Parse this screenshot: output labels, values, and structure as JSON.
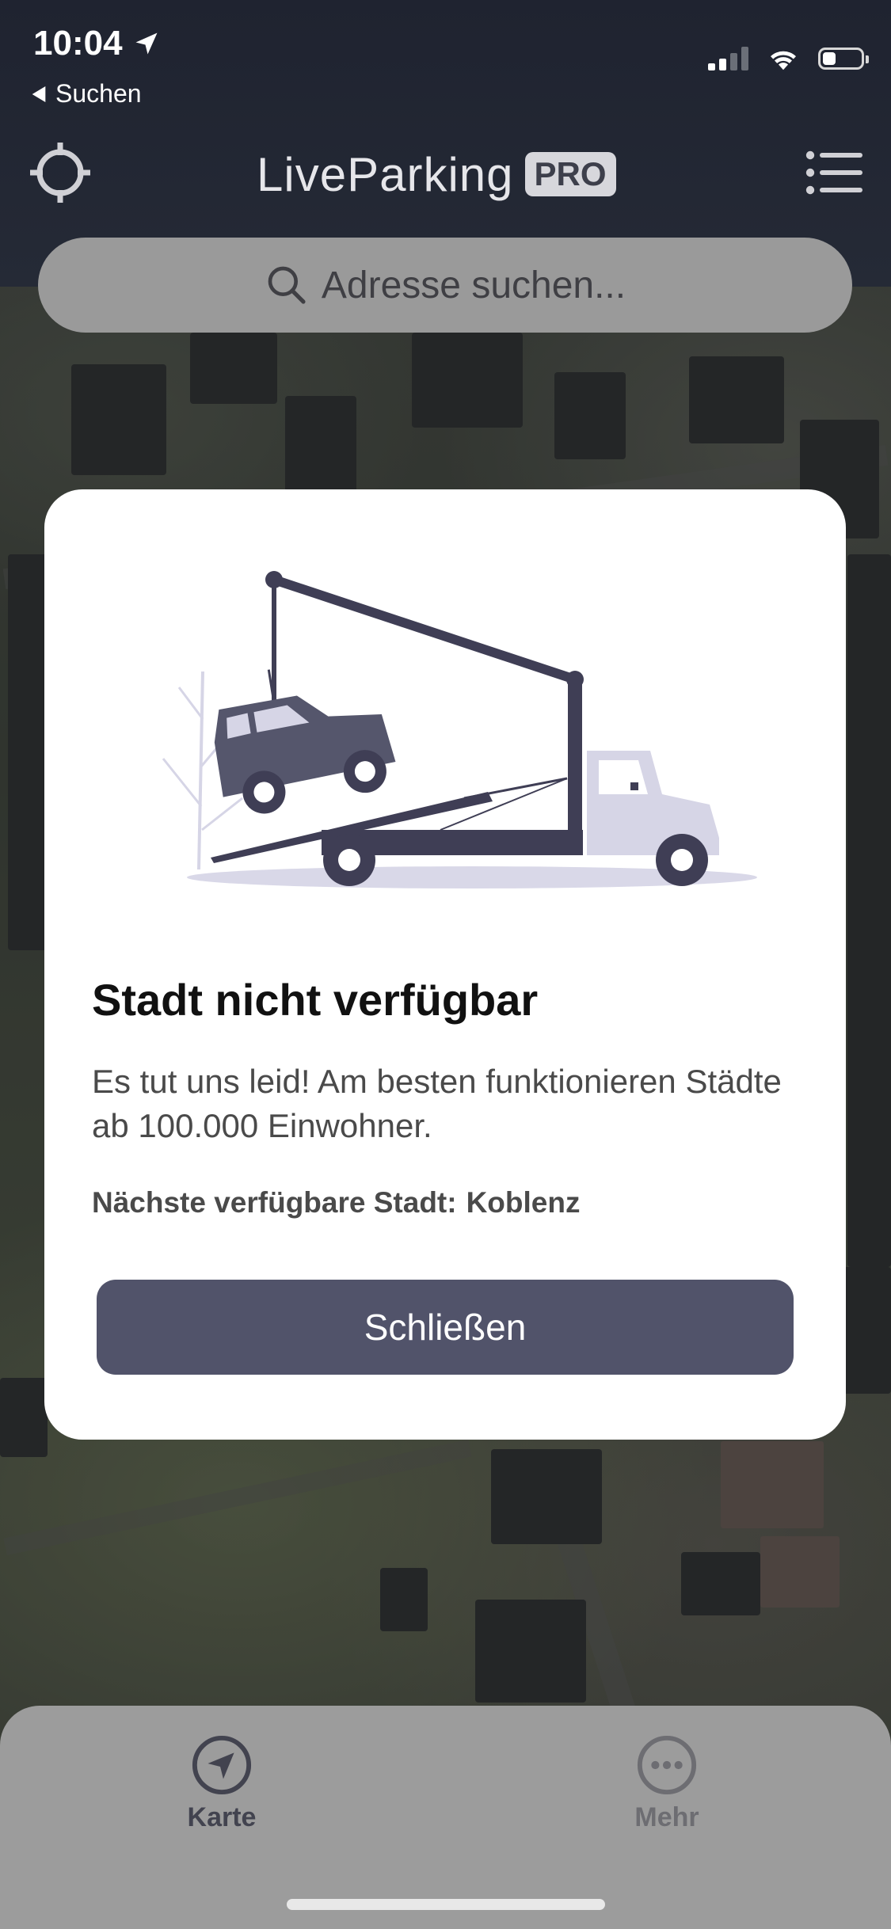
{
  "status_bar": {
    "time": "10:04",
    "back_label": "Suchen"
  },
  "header": {
    "logo_text": "LiveParking",
    "logo_badge": "PRO",
    "search_placeholder": "Adresse suchen..."
  },
  "modal": {
    "title": "Stadt nicht verfügbar",
    "description": "Es tut uns leid! Am besten funktionieren Städte ab 100.000 Einwohner.",
    "next_city_label": "Nächste verfügbare Stadt:",
    "next_city_value": "Koblenz",
    "close_button": "Schließen"
  },
  "tabbar": {
    "tabs": [
      {
        "label": "Karte",
        "icon": "navigation-arrow-icon",
        "active": true
      },
      {
        "label": "Mehr",
        "icon": "more-dots-icon",
        "active": false
      }
    ]
  },
  "colors": {
    "accent": "#51536a",
    "header_bg": "#232835",
    "tabbar_bg": "#9c9c9c"
  }
}
